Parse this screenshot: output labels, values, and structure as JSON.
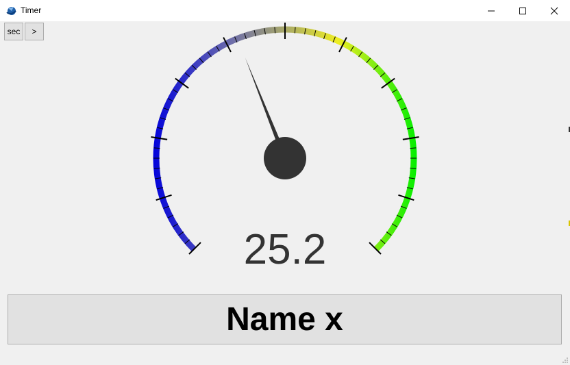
{
  "window": {
    "title": "Timer",
    "icon": "app-icon",
    "controls": [
      "minimize-icon",
      "maximize-icon",
      "close-icon"
    ]
  },
  "toolbar": {
    "unit_label": "sec",
    "next_label": ">"
  },
  "gauge": {
    "value": 25.2,
    "value_text": "25.2",
    "color_stops": [
      "#0000dd",
      "#777799",
      "#eeee22",
      "#00ee00"
    ]
  },
  "name_panel": {
    "text": "Name x"
  },
  "colors": {
    "background": "#f0f0f0",
    "needle": "#333333",
    "button_face": "#e1e1e1"
  }
}
